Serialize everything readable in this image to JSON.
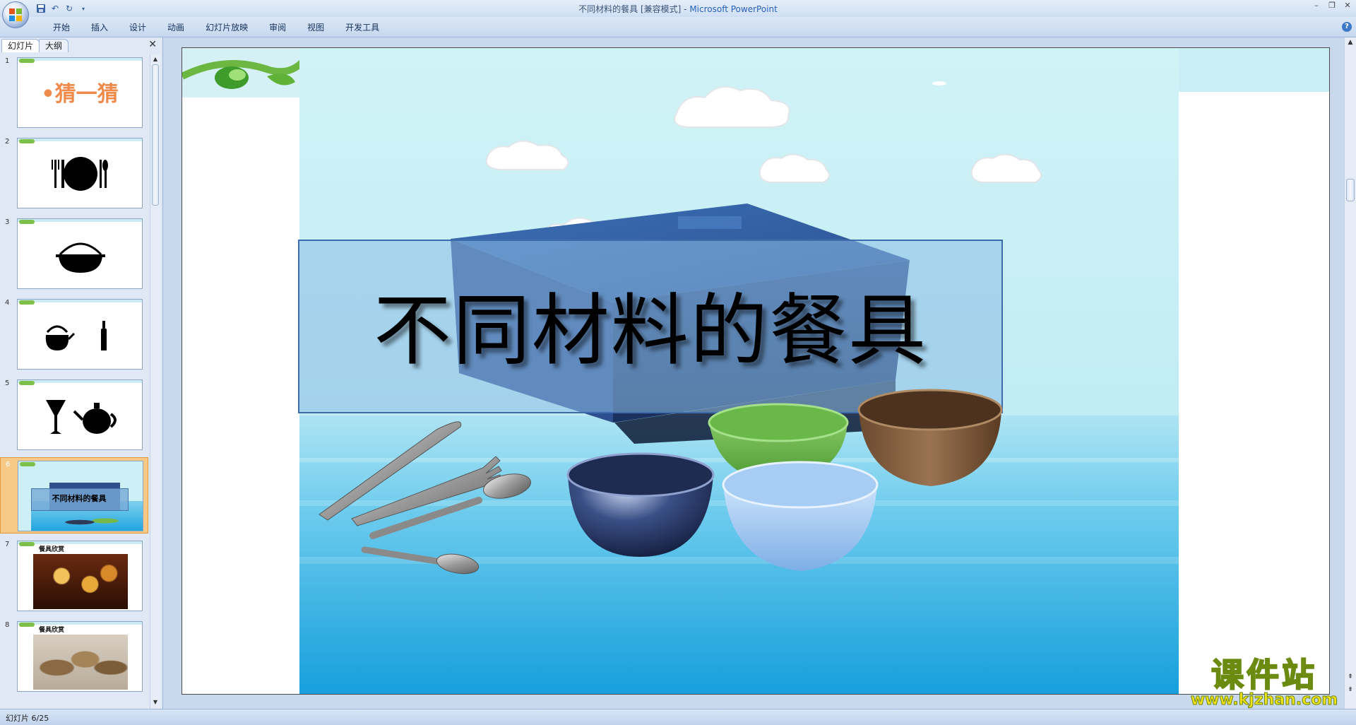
{
  "window": {
    "title": "不同材料的餐具 [兼容模式] - ",
    "app_name": "Microsoft PowerPoint",
    "qat": [
      "save-icon",
      "undo-icon",
      "redo-icon",
      "customize-icon"
    ],
    "controls": {
      "minimize": "–",
      "restore": "❐",
      "close": "✕"
    }
  },
  "ribbon": {
    "tabs": [
      "开始",
      "插入",
      "设计",
      "动画",
      "幻灯片放映",
      "审阅",
      "视图",
      "开发工具"
    ],
    "help": "?"
  },
  "left_pane": {
    "tabs": [
      "幻灯片",
      "大纲"
    ],
    "close": "✕",
    "thumbnails": [
      {
        "num": "1",
        "title": "•猜一猜"
      },
      {
        "num": "2"
      },
      {
        "num": "3"
      },
      {
        "num": "4"
      },
      {
        "num": "5"
      },
      {
        "num": "6",
        "title": "不同材料的餐具",
        "selected": true
      },
      {
        "num": "7",
        "title": "餐具欣赏"
      },
      {
        "num": "8",
        "title": "餐具欣赏"
      }
    ]
  },
  "slide": {
    "title": "不同材料的餐具"
  },
  "watermark": {
    "text": "课件站",
    "url": "www.kjzhan.com"
  },
  "status": {
    "text": "幻灯片 6/25"
  },
  "colors": {
    "accent": "#f08a4b",
    "ribbon_bg": "#c6d8ef",
    "sky": "#cdf0f6",
    "sea": "#2fb0e4"
  }
}
